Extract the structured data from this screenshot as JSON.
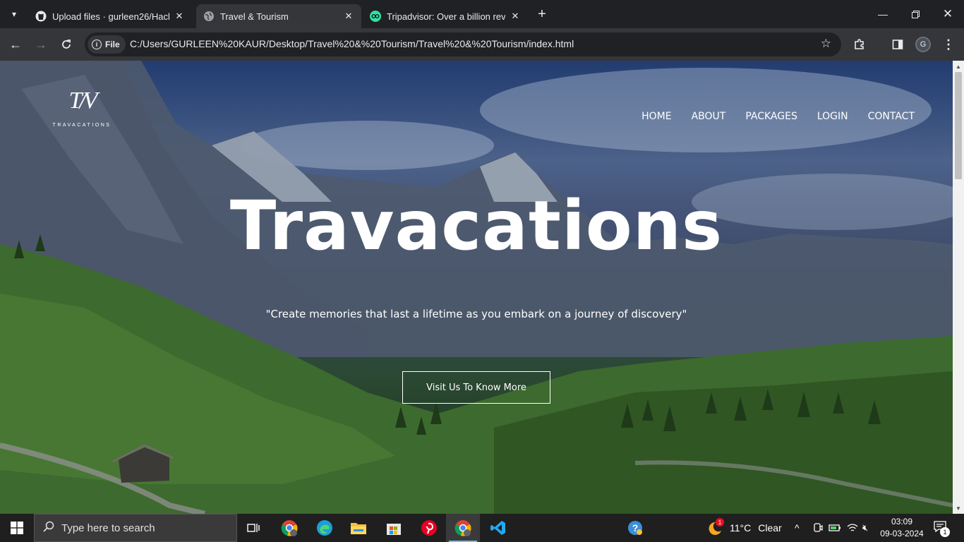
{
  "browser": {
    "tabs": [
      {
        "title": "Upload files · gurleen26/Hackat",
        "icon": "github-icon",
        "active": false
      },
      {
        "title": "Travel & Tourism",
        "icon": "globe-icon",
        "active": true
      },
      {
        "title": "Tripadvisor: Over a billion review",
        "icon": "tripadvisor-icon",
        "active": false
      }
    ],
    "file_chip": "File",
    "url": "C:/Users/GURLEEN%20KAUR/Desktop/Travel%20&%20Tourism/Travel%20&%20Tourism/index.html",
    "profile_initial": "G"
  },
  "site": {
    "logo_mark": "T/V",
    "logo_word": "TRAVACATIONS",
    "nav": [
      "HOME",
      "ABOUT",
      "PACKAGES",
      "LOGIN",
      "CONTACT"
    ],
    "hero_title": "Travacations",
    "tagline": "\"Create memories that last a lifetime as you embark on a journey of discovery\"",
    "cta": "Visit Us To Know More"
  },
  "taskbar": {
    "search_placeholder": "Type here to search",
    "weather_temp": "11°C",
    "weather_desc": "Clear",
    "weather_badge": "1",
    "time": "03:09",
    "date": "09-03-2024",
    "notification_count": "1"
  },
  "colors": {
    "chrome_bg": "#202124",
    "toolbar_bg": "#35363a",
    "taskbar_bg": "#1f1f1f"
  }
}
